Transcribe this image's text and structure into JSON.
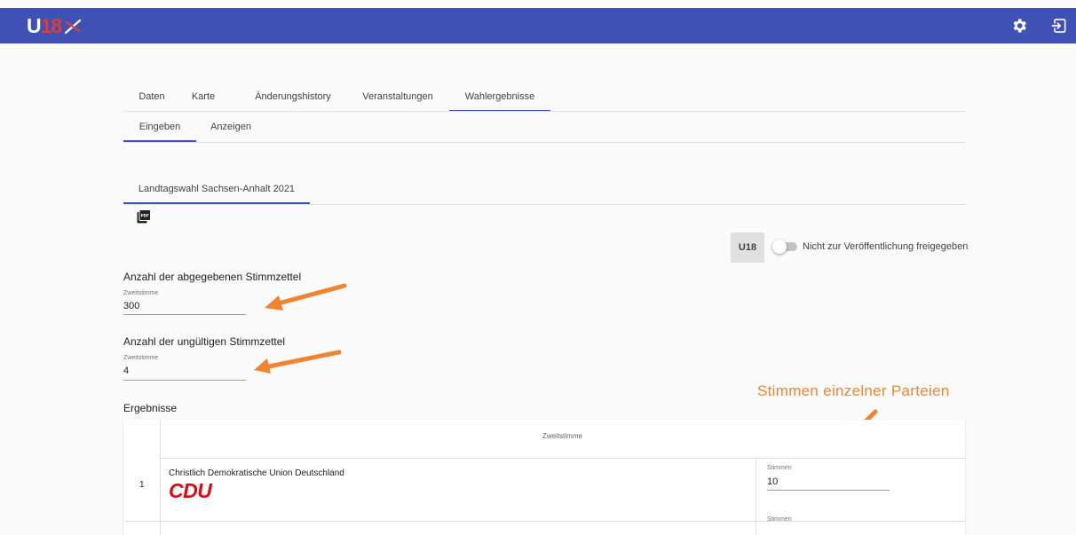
{
  "header": {
    "logo_letter": "U",
    "logo_number": "18",
    "icons": [
      "gear-icon",
      "exit-icon"
    ]
  },
  "tabs": [
    "Daten",
    "Karte",
    "Änderungshistory",
    "Veranstaltungen",
    "Wahlergebnisse"
  ],
  "subtabs": [
    "Eingeben",
    "Anzeigen"
  ],
  "election_tab": "Landtagswahl Sachsen-Anhalt 2021",
  "publish": {
    "badge": "U18",
    "status_label": "Nicht zur Veröffentlichung freigegeben",
    "enabled": false
  },
  "ballots_cast": {
    "title": "Anzahl der abgegebenen Stimmzettel",
    "field_label": "Zweitstimme",
    "value": "300"
  },
  "ballots_invalid": {
    "title": "Anzahl der ungültigen Stimmzettel",
    "field_label": "Zweitstimme",
    "value": "4"
  },
  "results": {
    "title": "Ergebnisse",
    "column_header": "Zweitstimme",
    "rows": [
      {
        "num": "1",
        "party": "Christlich Demokratische Union Deutschland",
        "logo": "CDU",
        "votes_label": "Stimmen",
        "votes": "10"
      },
      {
        "party": "",
        "votes_label": "Stimmen"
      }
    ]
  },
  "annotation": {
    "text": "Stimmen einzelner Parteien",
    "color": "#ef8532"
  },
  "colors": {
    "appbar": "#3f51b5",
    "accent": "#3f51b5",
    "cdu_red": "#e30613"
  }
}
